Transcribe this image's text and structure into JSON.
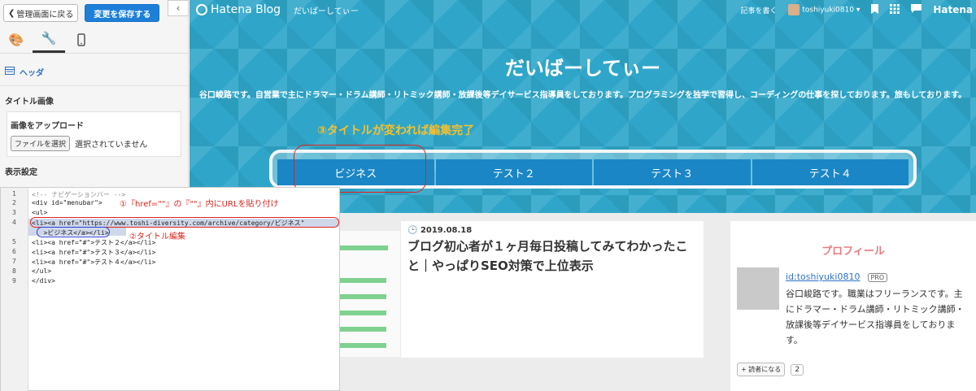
{
  "panel": {
    "back_label": "管理画面に戻る",
    "save_label": "変更を保存する",
    "collapse_glyph": "‹",
    "tab_icons": [
      "palette-icon",
      "wrench-icon",
      "mobile-icon"
    ],
    "section_title": "ヘッダ",
    "title_image_label": "タイトル画像",
    "upload_label": "画像をアップロード",
    "file_button": "ファイルを選択",
    "no_file": "選択されていません",
    "display_settings": "表示設定"
  },
  "globalheader": {
    "logo": "Hatena Blog",
    "blog_name": "だいばーしてぃー",
    "write": "記事を書く",
    "user": "toshiyuki0810",
    "brand": "Hatena"
  },
  "blog": {
    "title": "だいばーしてぃー",
    "description": "谷口峻路です。自営業で主にドラマー・ドラム講師・リトミック講師・放課後等デイサービス指導員をしております。プログラミングを独学で習得し、コーディングの仕事を探しております。旅もしております。",
    "annotation3": "③タイトルが変われば編集完了",
    "menu": [
      "ビジネス",
      "テスト２",
      "テスト３",
      "テスト４"
    ]
  },
  "entry": {
    "date": "2019.08.18",
    "title": "ブログ初心者が１ヶ月毎日投稿してみてわかったこと｜やっぱりSEO対策で上位表示"
  },
  "sidebar": {
    "title": "プロフィール",
    "user_id": "id:toshiyuki0810",
    "pro": "PRO",
    "bio": "谷口峻路です。職業はフリーランスです。主にドラマー・ドラム講師・リトミック講師・放課後等デイサービス指導員をしております。",
    "reader_button": "+ 読者になる",
    "reader_count": "2"
  },
  "code": {
    "line_numbers": [
      "1",
      "2",
      "3",
      "4",
      "",
      "5",
      "6",
      "7",
      "8",
      "9"
    ],
    "lines": [
      "<!-- ナビゲーションバー -->",
      "<div id=\"menubar\">",
      "<ul>",
      "<li><a href=\"https://www.toshi-diversity.com/archive/category/ビジネス\"",
      "   >ビジネス</a></li>",
      "<li><a href=\"#\">テスト２</a></li>",
      "<li><a href=\"#\">テスト３</a></li>",
      "<li><a href=\"#\">テスト４</a></li>",
      "</ul>",
      "</div>"
    ],
    "annotation1": "①『href=\"\"』の『\"\"』内にURLを貼り付け",
    "annotation2": "②タイトル編集"
  }
}
